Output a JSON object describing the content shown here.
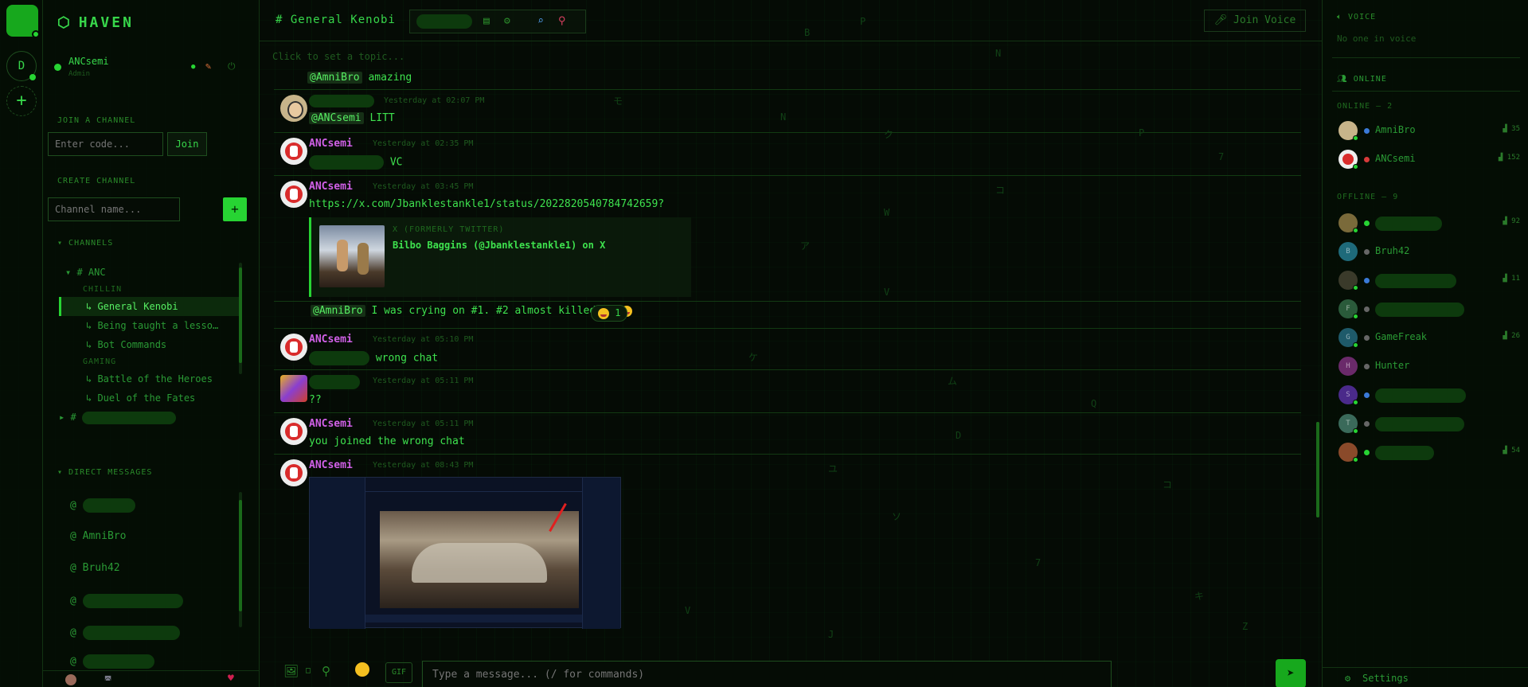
{
  "app": {
    "name": "HAVEN"
  },
  "rail": {
    "server_initial": "D"
  },
  "user": {
    "name": "ANCsemi",
    "role": "Admin"
  },
  "sidebar": {
    "join_label": "JOIN A CHANNEL",
    "code_placeholder": "Enter code...",
    "join_button": "Join",
    "create_label": "CREATE CHANNEL",
    "channel_name_placeholder": "Channel name...",
    "create_button": "+",
    "channels_label": "CHANNELS",
    "server_name": "ANC",
    "categories": [
      {
        "name": "CHILLIN",
        "channels": [
          "General Kenobi",
          "Being taught a lesso…",
          "Bot Commands"
        ]
      },
      {
        "name": "GAMING",
        "channels": [
          "Battle of the Heroes",
          "Duel of the Fates"
        ]
      }
    ],
    "dm_label": "DIRECT MESSAGES",
    "dms": [
      "AmniBro",
      "Bruh42"
    ]
  },
  "chat": {
    "channel_title": "# General Kenobi",
    "join_voice": "Join Voice",
    "topic_placeholder": "Click to set a topic...",
    "messages": [
      {
        "author": "",
        "time": "",
        "mention": "@AmniBro",
        "text": "amazing"
      },
      {
        "author": "",
        "time": "Yesterday at 02:07 PM",
        "mention": "@ANCsemi",
        "text": "LITT"
      },
      {
        "author": "ANCsemi",
        "time": "Yesterday at 02:35 PM",
        "mention": "",
        "text": "VC"
      },
      {
        "author": "ANCsemi",
        "time": "Yesterday at 03:45 PM",
        "mention": "",
        "text": "https://x.com/Jbanklestankle1/status/2022820540784742659?"
      },
      {
        "author": "",
        "time": "",
        "mention": "@AmniBro",
        "text": "I was crying on #1. #2 almost killed me"
      },
      {
        "author": "ANCsemi",
        "time": "Yesterday at 05:10 PM",
        "mention": "",
        "text": "wrong chat"
      },
      {
        "author": "",
        "time": "Yesterday at 05:11 PM",
        "mention": "",
        "text": "??"
      },
      {
        "author": "ANCsemi",
        "time": "Yesterday at 05:11 PM",
        "mention": "",
        "text": "you joined the wrong chat"
      },
      {
        "author": "ANCsemi",
        "time": "Yesterday at 08:43 PM",
        "mention": "",
        "text": ""
      }
    ],
    "embed": {
      "site": "X (FORMERLY TWITTER)",
      "title": "Bilbo Baggins (@Jbanklestankle1) on X"
    },
    "reaction_count": "1",
    "composer": {
      "gif": "GIF",
      "placeholder": "Type a message... (/ for commands)"
    }
  },
  "right": {
    "voice_label": "VOICE",
    "no_voice": "No one in voice",
    "online_header": "ONLINE",
    "online_label": "ONLINE — 2",
    "offline_label": "OFFLINE — 9",
    "online": [
      {
        "name": "AmniBro",
        "level": "35"
      },
      {
        "name": "ANCsemi",
        "level": "152"
      }
    ],
    "offline": [
      {
        "name": "",
        "initial": "",
        "level": "92"
      },
      {
        "name": "Bruh42",
        "initial": "B",
        "level": ""
      },
      {
        "name": "",
        "initial": "",
        "level": "11"
      },
      {
        "name": "",
        "initial": "F",
        "level": ""
      },
      {
        "name": "GameFreak",
        "initial": "G",
        "level": "26"
      },
      {
        "name": "Hunter",
        "initial": "H",
        "level": ""
      },
      {
        "name": "",
        "initial": "S",
        "level": ""
      },
      {
        "name": "",
        "initial": "T",
        "level": ""
      },
      {
        "name": "",
        "initial": "",
        "level": "54"
      }
    ],
    "settings": "Settings"
  },
  "colors": {
    "accent": "#27d433",
    "author": "#d160e8",
    "background": "#050b05"
  }
}
